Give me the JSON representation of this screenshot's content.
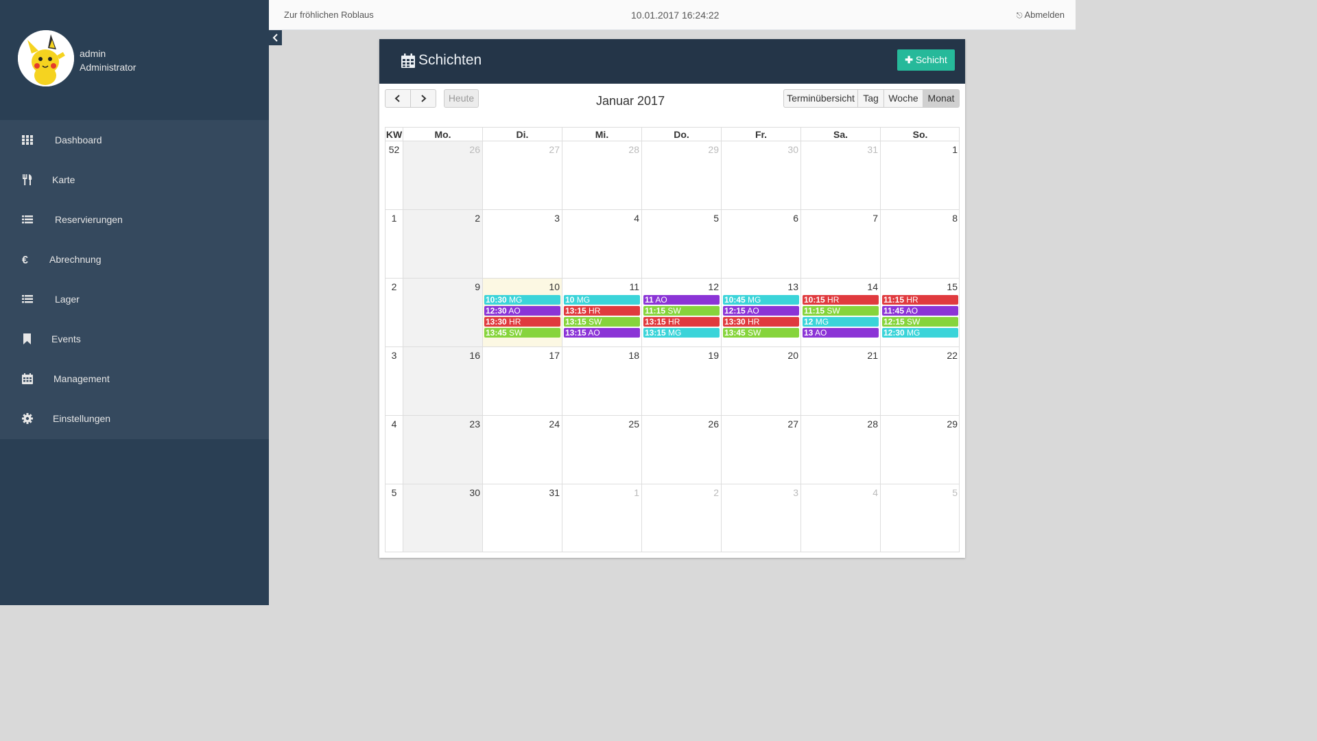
{
  "profile": {
    "name": "admin",
    "role": "Administrator"
  },
  "menu": [
    {
      "label": "Dashboard",
      "icon": "th-icon"
    },
    {
      "label": "Karte",
      "icon": "cutlery-icon"
    },
    {
      "label": "Reservierungen",
      "icon": "list-icon"
    },
    {
      "label": "Abrechnung",
      "icon": "euro-icon"
    },
    {
      "label": "Lager",
      "icon": "list-icon"
    },
    {
      "label": "Events",
      "icon": "bookmark-icon"
    },
    {
      "label": "Management",
      "icon": "calendar-icon"
    },
    {
      "label": "Einstellungen",
      "icon": "gear-icon"
    }
  ],
  "topbar": {
    "site": "Zur fröhlichen Roblaus",
    "clock": "10.01.2017 16:24:22",
    "logout": "Abmelden"
  },
  "panel": {
    "title": "Schichten",
    "add_label": "Schicht"
  },
  "toolbar": {
    "today": "Heute",
    "month_title": "Januar 2017",
    "views": [
      "Terminübersicht",
      "Tag",
      "Woche",
      "Monat"
    ],
    "active_view": "Monat"
  },
  "calendar": {
    "headers": [
      "KW",
      "Mo.",
      "Di.",
      "Mi.",
      "Do.",
      "Fr.",
      "Sa.",
      "So."
    ],
    "weeks": [
      {
        "kw": "52",
        "days": [
          "26",
          "27",
          "28",
          "29",
          "30",
          "31",
          "1"
        ],
        "other": [
          true,
          true,
          true,
          true,
          true,
          true,
          false
        ]
      },
      {
        "kw": "1",
        "days": [
          "2",
          "3",
          "4",
          "5",
          "6",
          "7",
          "8"
        ],
        "other": [
          false,
          false,
          false,
          false,
          false,
          false,
          false
        ]
      },
      {
        "kw": "2",
        "days": [
          "9",
          "10",
          "11",
          "12",
          "13",
          "14",
          "15"
        ],
        "other": [
          false,
          false,
          false,
          false,
          false,
          false,
          false
        ]
      },
      {
        "kw": "3",
        "days": [
          "16",
          "17",
          "18",
          "19",
          "20",
          "21",
          "22"
        ],
        "other": [
          false,
          false,
          false,
          false,
          false,
          false,
          false
        ]
      },
      {
        "kw": "4",
        "days": [
          "23",
          "24",
          "25",
          "26",
          "27",
          "28",
          "29"
        ],
        "other": [
          false,
          false,
          false,
          false,
          false,
          false,
          false
        ]
      },
      {
        "kw": "5",
        "days": [
          "30",
          "31",
          "1",
          "2",
          "3",
          "4",
          "5"
        ],
        "other": [
          false,
          false,
          true,
          true,
          true,
          true,
          true
        ]
      }
    ],
    "today_cell": {
      "week": 2,
      "day": 1
    },
    "colors": {
      "MG": "#3bd4d9",
      "AO": "#8b34d6",
      "HR": "#e03a3e",
      "SW": "#86d43c"
    },
    "events": [
      {
        "week": 2,
        "day": 1,
        "items": [
          {
            "time": "10:30",
            "who": "MG"
          },
          {
            "time": "12:30",
            "who": "AO"
          },
          {
            "time": "13:30",
            "who": "HR"
          },
          {
            "time": "13:45",
            "who": "SW"
          }
        ]
      },
      {
        "week": 2,
        "day": 2,
        "items": [
          {
            "time": "10",
            "who": "MG"
          },
          {
            "time": "13:15",
            "who": "HR"
          },
          {
            "time": "13:15",
            "who": "SW"
          },
          {
            "time": "13:15",
            "who": "AO"
          }
        ]
      },
      {
        "week": 2,
        "day": 3,
        "items": [
          {
            "time": "11",
            "who": "AO"
          },
          {
            "time": "11:15",
            "who": "SW"
          },
          {
            "time": "13:15",
            "who": "HR"
          },
          {
            "time": "13:15",
            "who": "MG"
          }
        ]
      },
      {
        "week": 2,
        "day": 4,
        "items": [
          {
            "time": "10:45",
            "who": "MG"
          },
          {
            "time": "12:15",
            "who": "AO"
          },
          {
            "time": "13:30",
            "who": "HR"
          },
          {
            "time": "13:45",
            "who": "SW"
          }
        ]
      },
      {
        "week": 2,
        "day": 5,
        "items": [
          {
            "time": "10:15",
            "who": "HR"
          },
          {
            "time": "11:15",
            "who": "SW"
          },
          {
            "time": "12",
            "who": "MG"
          },
          {
            "time": "13",
            "who": "AO"
          }
        ]
      },
      {
        "week": 2,
        "day": 6,
        "items": [
          {
            "time": "11:15",
            "who": "HR"
          },
          {
            "time": "11:45",
            "who": "AO"
          },
          {
            "time": "12:15",
            "who": "SW"
          },
          {
            "time": "12:30",
            "who": "MG"
          }
        ]
      }
    ]
  }
}
